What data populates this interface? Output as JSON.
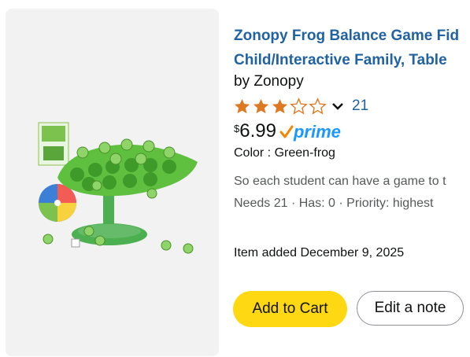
{
  "product": {
    "title_line1": "Zonopy Frog Balance Game Fid",
    "title_line2": "Child/Interactive Family, Table",
    "byline": "by Zonopy",
    "rating": {
      "stars": 3.0,
      "max": 5,
      "count": "21"
    },
    "price": {
      "currency": "$",
      "amount": "6.99"
    },
    "prime_label": "prime",
    "color": "Color : Green-frog",
    "note": "So each student can have a game to t",
    "needs": "Needs 21 · Has: 0 · Priority: highest",
    "added": "Item added December 9, 2025"
  },
  "actions": {
    "add_to_cart": "Add to Cart",
    "edit_note": "Edit a note"
  },
  "colors": {
    "link": "#2162a1",
    "star": "#de7921",
    "cart_button": "#ffd814",
    "prime": "#1a98ff"
  },
  "icons": {
    "rating_dropdown": "chevron-down-icon",
    "prime_check": "prime-check-icon"
  }
}
